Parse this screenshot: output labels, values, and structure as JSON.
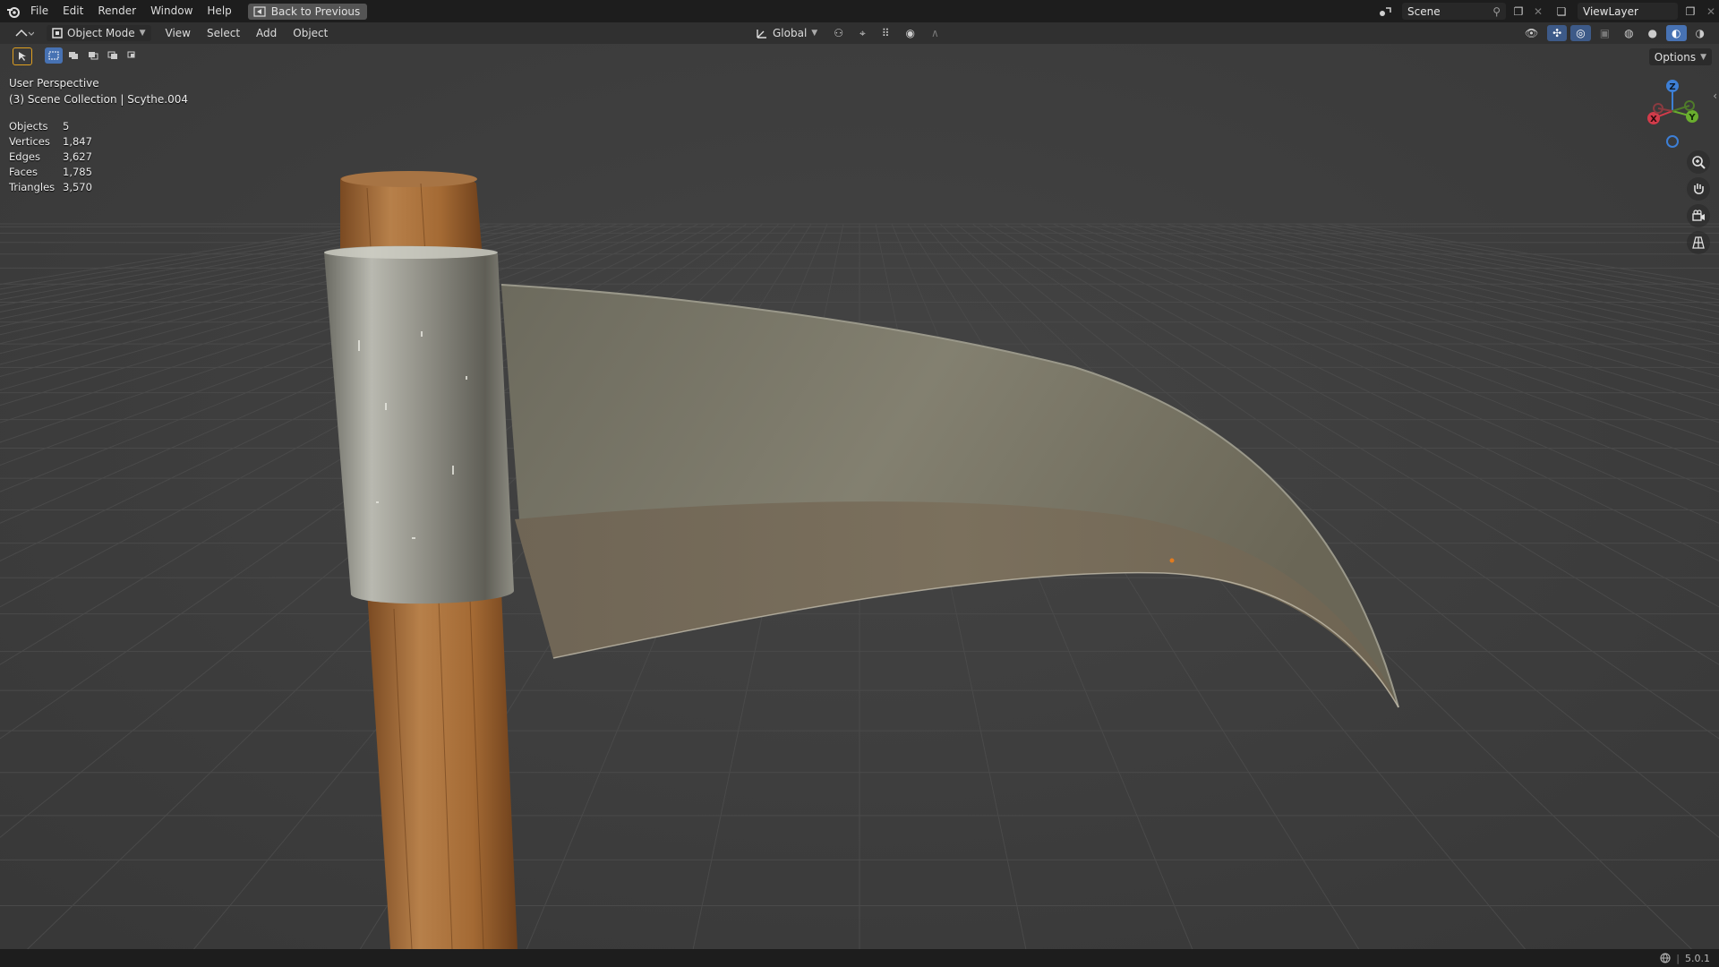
{
  "topbar": {
    "menus": [
      "File",
      "Edit",
      "Render",
      "Window",
      "Help"
    ],
    "back_button": "Back to Previous",
    "scene": "Scene",
    "view_layer": "ViewLayer"
  },
  "header": {
    "mode": "Object Mode",
    "menus": [
      "View",
      "Select",
      "Add",
      "Object"
    ],
    "transform_orientation": "Global"
  },
  "viewport": {
    "perspective": "User Perspective",
    "collection": "(3) Scene Collection | Scythe.004",
    "options_label": "Options",
    "stats": [
      {
        "label": "Objects",
        "value": "5"
      },
      {
        "label": "Vertices",
        "value": "1,847"
      },
      {
        "label": "Edges",
        "value": "3,627"
      },
      {
        "label": "Faces",
        "value": "1,785"
      },
      {
        "label": "Triangles",
        "value": "3,570"
      }
    ],
    "gizmo": {
      "x": "X",
      "y": "Y",
      "z": "Z"
    }
  },
  "statusbar": {
    "version": "5.0.1"
  },
  "icons": [
    "blender-logo-icon",
    "back-icon",
    "editor-type-icon",
    "object-mode-icon",
    "select-box-icon",
    "global-axis-icon",
    "snap-icon",
    "proportional-icon",
    "visibility-icon",
    "gizmo-icon",
    "overlay-icon",
    "xray-icon",
    "wireframe-shading-icon",
    "solid-shading-icon",
    "material-shading-icon",
    "rendered-shading-icon",
    "zoom-icon",
    "hand-pan-icon",
    "camera-icon",
    "grid-icon",
    "globe-icon"
  ]
}
